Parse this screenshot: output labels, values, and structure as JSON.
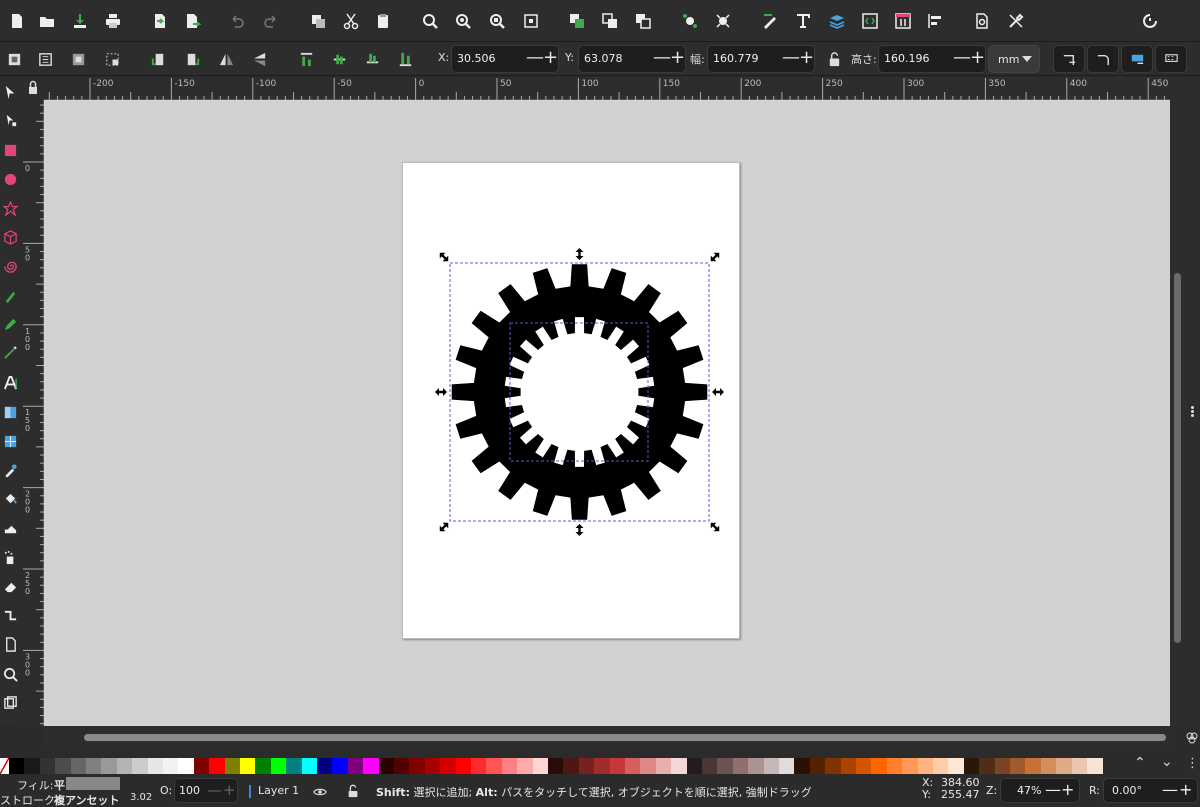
{
  "toolbar": {
    "commands": [
      "new-doc-icon",
      "open-icon",
      "save-icon",
      "print-icon",
      "import-icon",
      "export-icon",
      "undo-icon",
      "redo-icon",
      "duplicate-icon",
      "cut-icon",
      "paste-icon",
      "zoom-selection-icon",
      "zoom-drawing-icon",
      "zoom-page-icon",
      "zoom-page-width-icon",
      "group-icon",
      "ungroup-icon",
      "clone-icon",
      "snap-icon",
      "node-snap-icon",
      "xml-editor-icon",
      "text-font-icon",
      "layers-icon",
      "xml-icon",
      "objects-icon",
      "align-icon",
      "document-properties-icon",
      "preferences-icon"
    ]
  },
  "controls": {
    "x_label": "X:",
    "x_value": "30.506",
    "y_label": "Y:",
    "y_value": "63.078",
    "w_label": "幅:",
    "w_value": "160.779",
    "h_label": "高さ:",
    "h_value": "160.196",
    "unit": "mm",
    "minus": "—",
    "plus": "+"
  },
  "ruler": {
    "top": [
      "-200",
      "-150",
      "-100",
      "-50",
      "0",
      "50",
      "100",
      "150",
      "200",
      "250",
      "300",
      "350",
      "400",
      "450"
    ],
    "left": [
      "0",
      "50",
      "100",
      "150",
      "200",
      "250",
      "300"
    ]
  },
  "palette": {
    "colors": [
      "#000000",
      "#1a1a1a",
      "#333333",
      "#4d4d4d",
      "#666666",
      "#808080",
      "#999999",
      "#b3b3b3",
      "#cccccc",
      "#e6e6e6",
      "#f2f2f2",
      "#ffffff",
      "#800000",
      "#ff0000",
      "#808000",
      "#ffff00",
      "#008000",
      "#00ff00",
      "#008080",
      "#00ffff",
      "#000080",
      "#0000ff",
      "#800080",
      "#ff00ff",
      "#2b0000",
      "#550000",
      "#800000",
      "#aa0000",
      "#d40000",
      "#ff0000",
      "#ff2a2a",
      "#ff5555",
      "#ff8080",
      "#ffaaaa",
      "#ffd5d5",
      "#280b0b",
      "#501616",
      "#782121",
      "#a02c2c",
      "#c83737",
      "#d35f5f",
      "#de8787",
      "#e9afaf",
      "#f4d7d7",
      "#241c1c",
      "#483737",
      "#6c5353",
      "#916f6f",
      "#ac9393",
      "#c8b7b7",
      "#e3dbdb",
      "#2b1100",
      "#552200",
      "#803300",
      "#aa4400",
      "#d45500",
      "#ff6600",
      "#ff7f2a",
      "#ff9955",
      "#ffb380",
      "#ffccaa",
      "#ffe6d5",
      "#28170b",
      "#502d16",
      "#784421",
      "#a05a2c",
      "#c87137",
      "#d38d5f",
      "#deaa87",
      "#e9c6af",
      "#f4e3d7"
    ]
  },
  "status": {
    "fill_label": "フィル:",
    "fill_value": "平",
    "stroke_label": "ストローク:",
    "stroke_value": "複アンセット",
    "stroke_width": "3.02",
    "opacity_label": "O:",
    "opacity_value": "100",
    "layer_name": "Layer 1",
    "message_shift": "Shift:",
    "message_1": " 選択に追加; ",
    "message_alt": "Alt:",
    "message_2": " パスをタッチして選択, オブジェクトを順に選択, 強制ドラッグ",
    "cursor_x_label": "X:",
    "cursor_x": "384.60",
    "cursor_y_label": "Y:",
    "cursor_y": "255.47",
    "zoom_label": "Z:",
    "zoom": "47%",
    "rotate_label": "R:",
    "rotate": "0.00°"
  },
  "colors": {
    "accent_green": "#3fa94b",
    "selection_dash": "#5a5adc",
    "canvas_bg": "#d2d2d2"
  }
}
